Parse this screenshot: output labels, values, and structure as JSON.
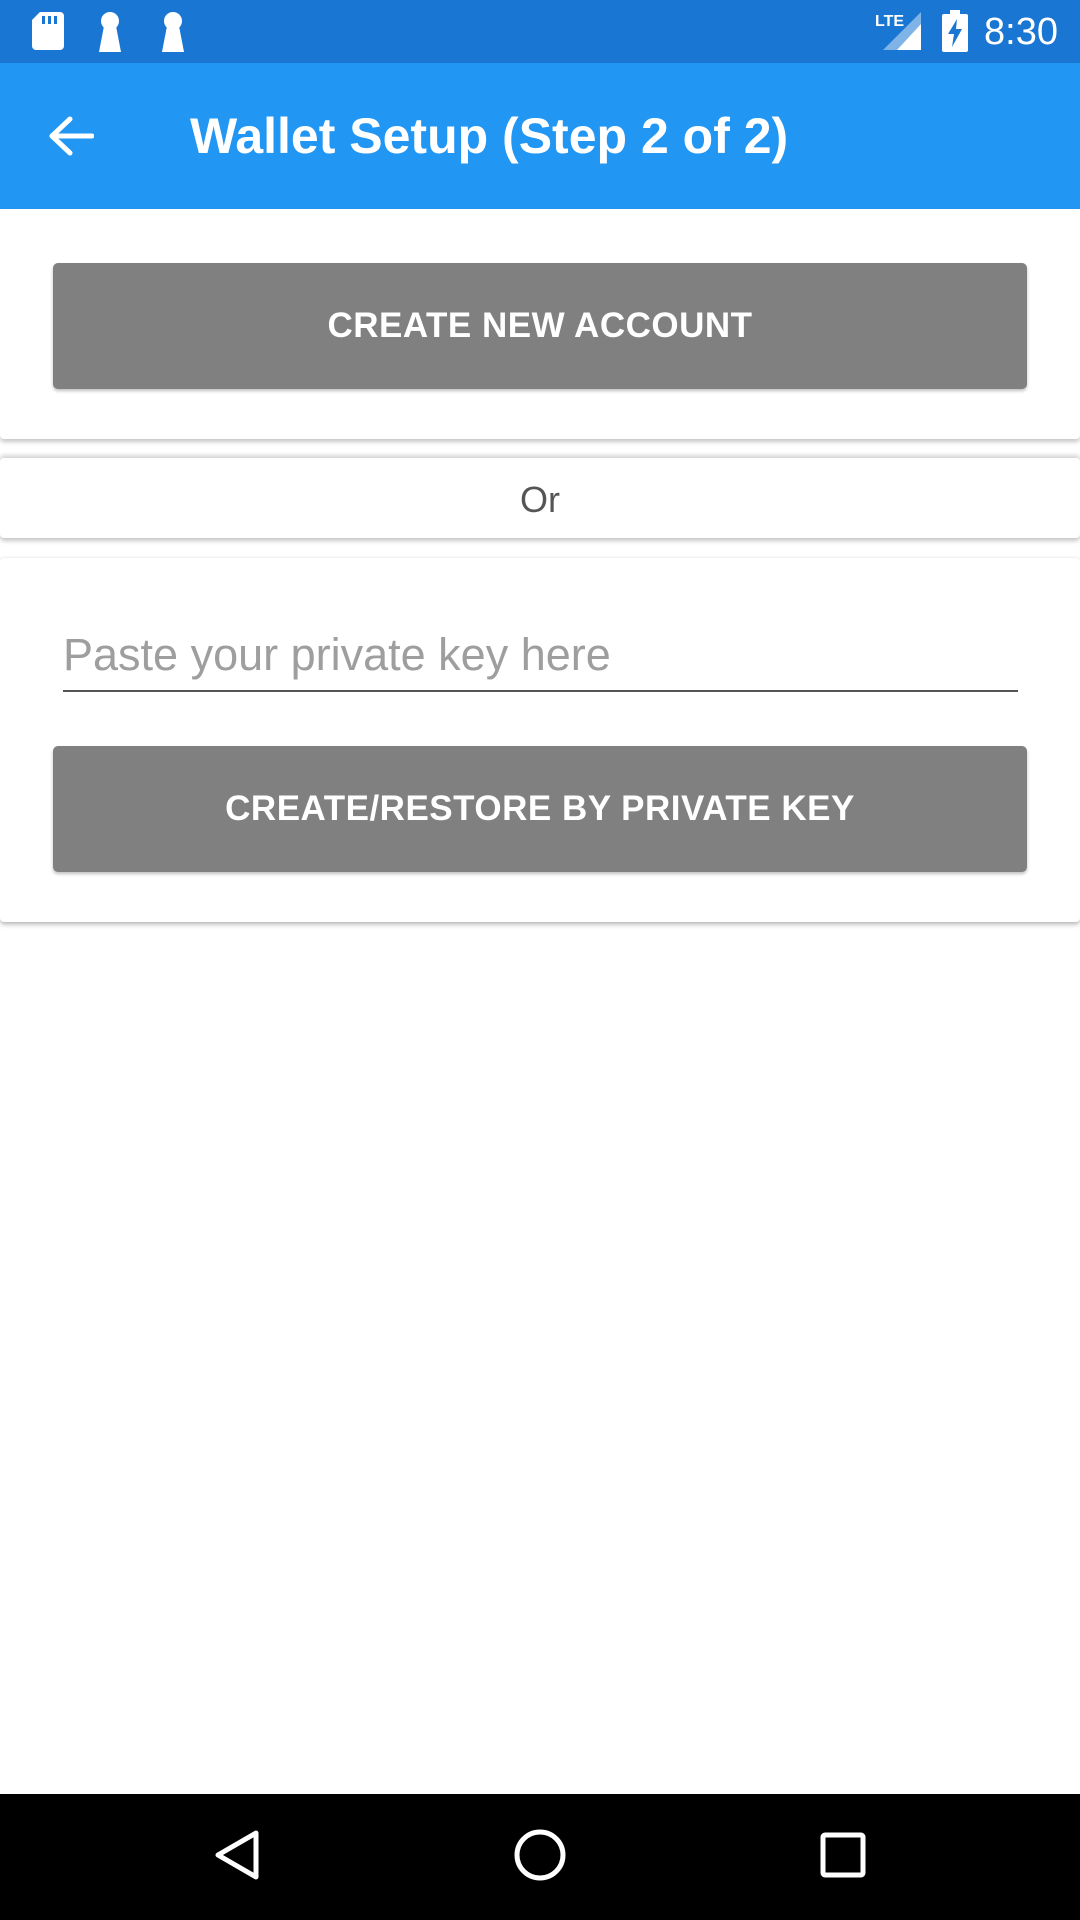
{
  "status_bar": {
    "time": "8:30",
    "network_label": "LTE",
    "icons": [
      "sd-card-icon",
      "keyhole-icon",
      "keyhole-icon",
      "lte-signal-icon",
      "battery-charging-icon"
    ]
  },
  "app_bar": {
    "title": "Wallet Setup (Step 2 of 2)",
    "back_icon": "arrow-back-icon"
  },
  "create_section": {
    "button_label": "CREATE NEW ACCOUNT"
  },
  "divider": {
    "text": "Or"
  },
  "restore_section": {
    "input_placeholder": "Paste your private key here",
    "input_value": "",
    "button_label": "CREATE/RESTORE BY PRIVATE KEY"
  },
  "nav_bar": {
    "icons": [
      "back-triangle-icon",
      "home-circle-icon",
      "recents-square-icon"
    ]
  },
  "colors": {
    "status_bar": "#1976d2",
    "app_bar": "#2196f3",
    "button": "#808080",
    "nav_bar": "#000000"
  }
}
